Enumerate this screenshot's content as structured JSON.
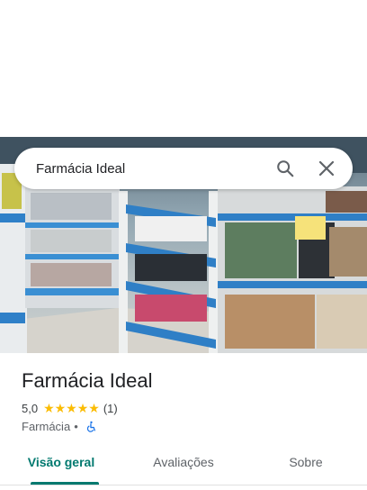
{
  "search": {
    "query": "Farmácia Ideal"
  },
  "icons": {
    "search": "search-icon",
    "close": "close-icon",
    "wheelchair": "wheelchair-accessible-icon"
  },
  "place": {
    "name": "Farmácia Ideal",
    "rating": "5,0",
    "stars": "★★★★★",
    "rating_value": 5.0,
    "review_count": "(1)",
    "category": "Farmácia",
    "separator": "•"
  },
  "tabs": [
    {
      "label": "Visão geral",
      "active": true
    },
    {
      "label": "Avaliações",
      "active": false
    },
    {
      "label": "Sobre",
      "active": false
    }
  ],
  "colors": {
    "accent": "#01796f",
    "star": "#fbbc04",
    "accessibility": "#1a73e8"
  }
}
